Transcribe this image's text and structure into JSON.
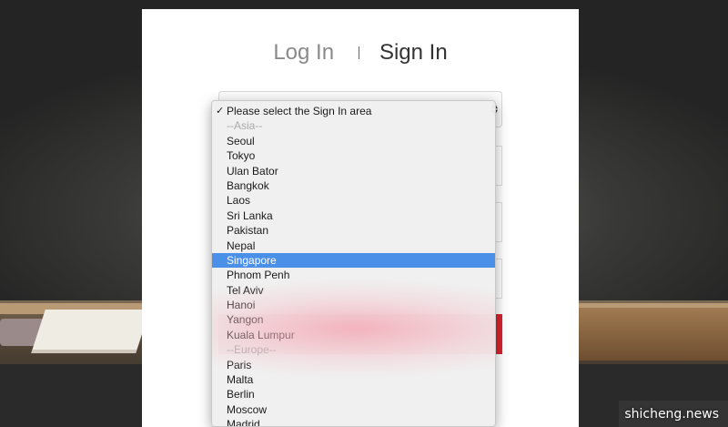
{
  "tabs": {
    "login": "Log In",
    "signin": "Sign In"
  },
  "dropdown": {
    "placeholder": "Please select the Sign In area",
    "check_glyph": "✓",
    "options": [
      {
        "label": "--Asia--",
        "type": "group"
      },
      {
        "label": "Seoul",
        "type": "option"
      },
      {
        "label": "Tokyo",
        "type": "option"
      },
      {
        "label": "Ulan Bator",
        "type": "option"
      },
      {
        "label": "Bangkok",
        "type": "option"
      },
      {
        "label": "Laos",
        "type": "option"
      },
      {
        "label": "Sri Lanka",
        "type": "option"
      },
      {
        "label": "Pakistan",
        "type": "option"
      },
      {
        "label": "Nepal",
        "type": "option"
      },
      {
        "label": "Singapore",
        "type": "selected"
      },
      {
        "label": "Phnom Penh",
        "type": "option"
      },
      {
        "label": "Tel Aviv",
        "type": "option"
      },
      {
        "label": "Hanoi",
        "type": "option"
      },
      {
        "label": "Yangon",
        "type": "option"
      },
      {
        "label": "Kuala Lumpur",
        "type": "option"
      },
      {
        "label": "--Europe--",
        "type": "group"
      },
      {
        "label": "Paris",
        "type": "option"
      },
      {
        "label": "Malta",
        "type": "option"
      },
      {
        "label": "Berlin",
        "type": "option"
      },
      {
        "label": "Moscow",
        "type": "option"
      },
      {
        "label": "Madrid",
        "type": "option"
      }
    ]
  },
  "select_arrows_icon": "up-down-arrows-icon",
  "colors": {
    "highlight": "#4a90e9",
    "submit_red": "#d9232e"
  },
  "watermark": "shicheng.news"
}
